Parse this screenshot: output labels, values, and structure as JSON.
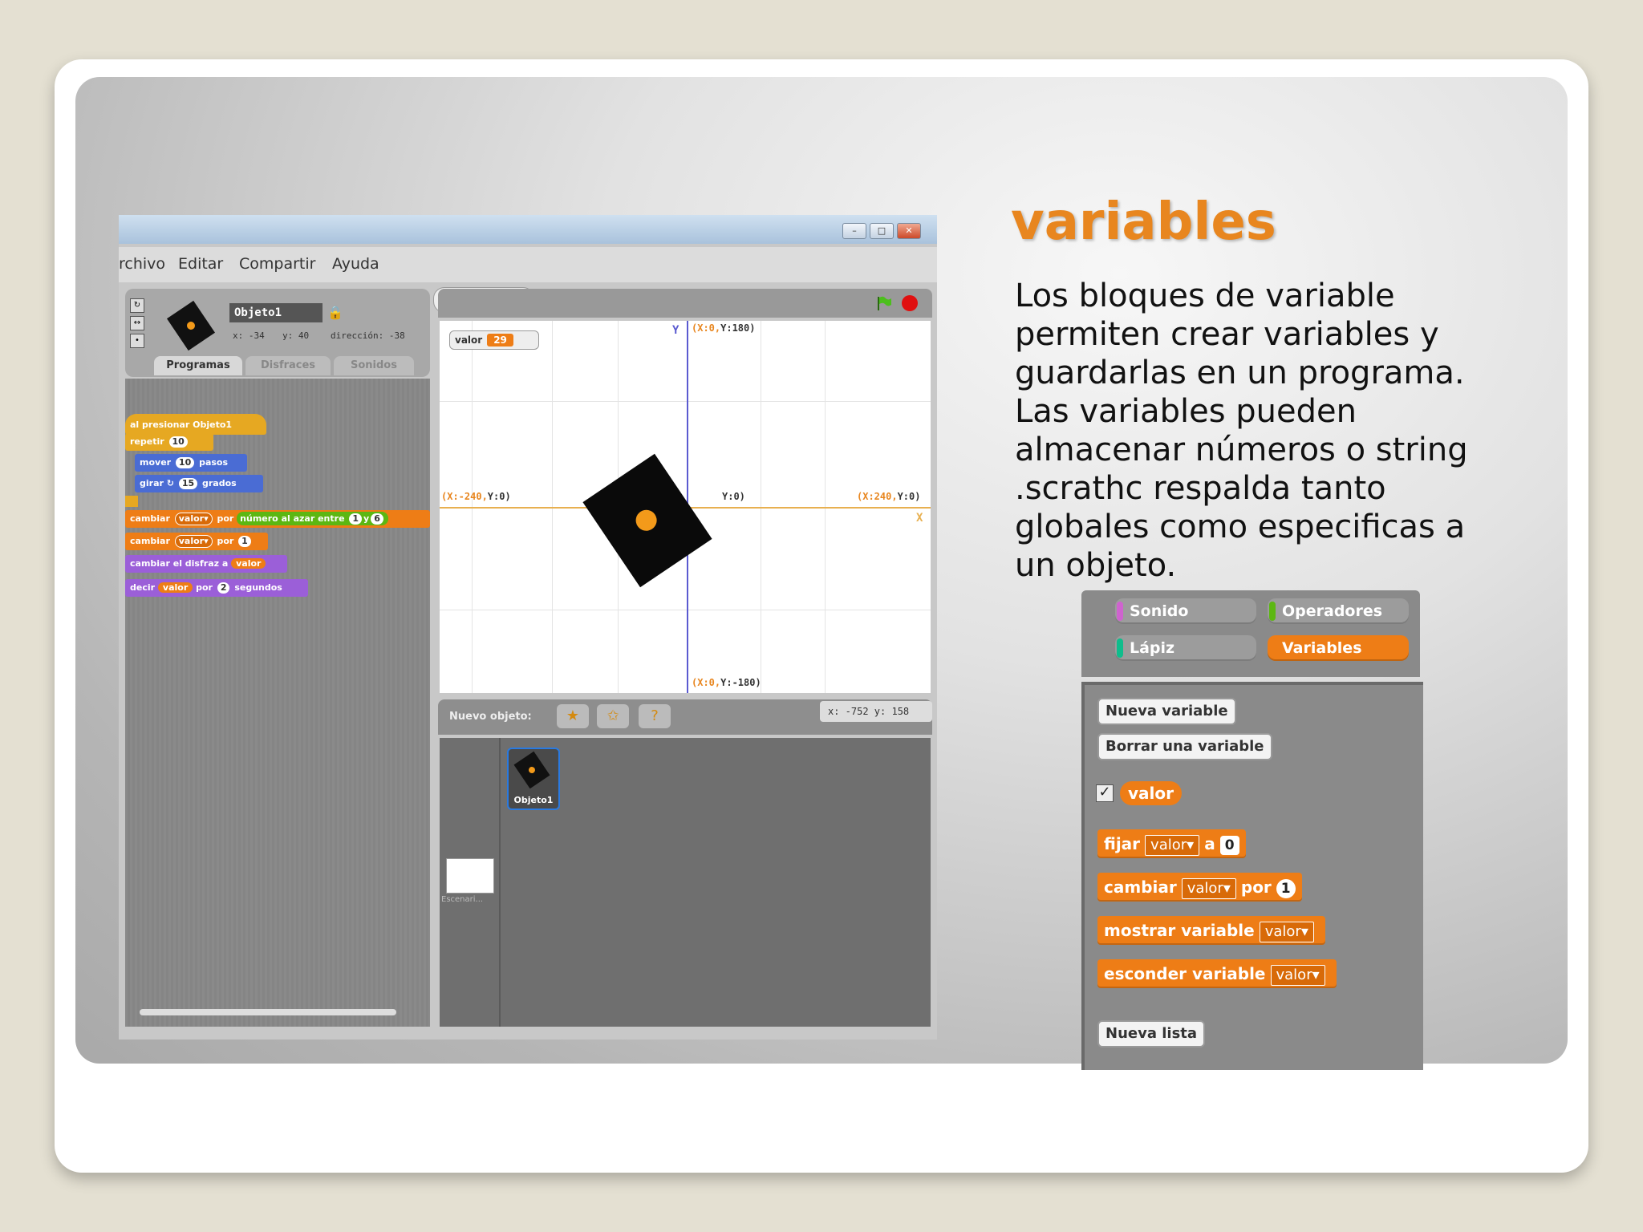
{
  "slide": {
    "title": "variables",
    "body_lines": [
      "Los bloques de variable",
      "permiten crear variables y",
      "guardarlas en un programa.",
      "Las variables pueden",
      "almacenar números o string",
      ".scrathc respalda tanto",
      "globales como especificas a",
      "un objeto."
    ]
  },
  "scratch": {
    "menu": [
      "rchivo",
      "Editar",
      "Compartir",
      "Ayuda"
    ],
    "sprite": {
      "name": "Objeto1",
      "x_label": "x: -34",
      "y_label": "y: 40",
      "direction_label": "dirección: -38"
    },
    "tabs": [
      "Programas",
      "Disfraces",
      "Sonidos"
    ],
    "script_blocks": {
      "hat": "al presionar Objeto1",
      "repeat_label": "repetir",
      "repeat_n": "10",
      "move_label": "mover",
      "move_n": "10",
      "move_unit": "pasos",
      "turn_label": "girar ↻",
      "turn_n": "15",
      "turn_unit": "grados",
      "change_by_random_a": "cambiar",
      "change_by_random_var": "valor▾",
      "change_by_random_b": "por",
      "random_label": "número al azar entre",
      "random_from": "1",
      "random_and": "y",
      "random_to": "6",
      "change_by_a": "cambiar",
      "change_by_var": "valor▾",
      "change_by_b": "por",
      "change_by_n": "1",
      "costume_label": "cambiar el disfraz a",
      "costume_var": "valor",
      "say_label": "decir",
      "say_var": "valor",
      "say_por": "por",
      "say_n": "2",
      "say_unit": "segundos"
    },
    "stage": {
      "monitor_name": "valor",
      "monitor_value": "29",
      "axis_y": "Y",
      "axis_x": "X",
      "top_label_a": "(X:0,",
      "top_label_b": "Y:180)",
      "bottom_label_a": "(X:0,",
      "bottom_label_b": "Y:-180)",
      "left_label_a": "(X:-240,",
      "left_label_b": "Y:0)",
      "right_label_a": "(X:240,",
      "right_label_b": "Y:0)",
      "center_label": "Y:0)"
    },
    "new_sprite_label": "Nuevo objeto:",
    "mouse_xy": "x: -752  y: 158",
    "sprite_list": {
      "sprite_name": "Objeto1",
      "stage_name": "Escenari..."
    }
  },
  "palette": {
    "categories": [
      "Sonido",
      "Operadores",
      "Lápiz",
      "Variables"
    ],
    "category_colors": [
      "#cf63cf",
      "#5cb712",
      "#0fbd8c",
      "#ee7d16"
    ],
    "new_variable": "Nueva variable",
    "delete_variable": "Borrar una variable",
    "reporter": "valor",
    "set_label": "fijar",
    "set_var": "valor▾",
    "set_to": "a",
    "set_value": "0",
    "change_label": "cambiar",
    "change_var": "valor▾",
    "change_by": "por",
    "change_value": "1",
    "show_label": "mostrar variable",
    "show_var": "valor▾",
    "hide_label": "esconder variable",
    "hide_var": "valor▾",
    "new_list": "Nueva lista"
  },
  "colors": {
    "accent_orange": "#ee7d16",
    "title_orange": "#e8861f"
  }
}
